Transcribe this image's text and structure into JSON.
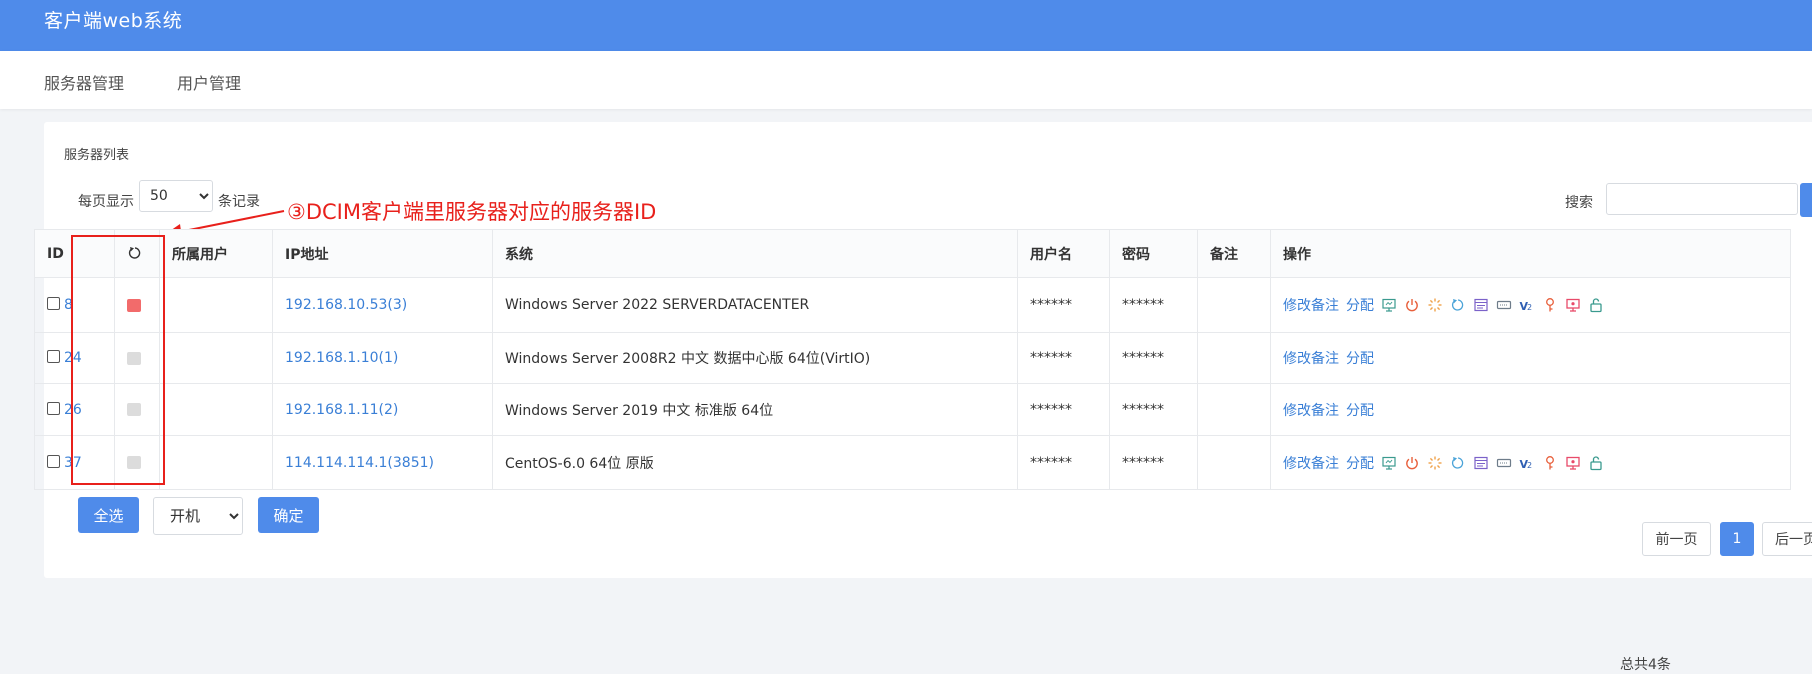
{
  "header": {
    "title": "客户端web系统"
  },
  "nav": {
    "items": [
      {
        "label": "服务器管理"
      },
      {
        "label": "用户管理"
      }
    ]
  },
  "card": {
    "title": "服务器列表"
  },
  "controls": {
    "page_size_label": "每页显示",
    "page_size_value": "50",
    "records_label": "条记录",
    "search_label": "搜索",
    "search_placeholder": ""
  },
  "annotation": {
    "text": "③DCIM客户端里服务器对应的服务器ID",
    "color": "#e8201b"
  },
  "table": {
    "columns": [
      "ID",
      "所属用户",
      "IP地址",
      "系统",
      "用户名",
      "密码",
      "备注",
      "操作"
    ],
    "rows": [
      {
        "id": "8",
        "status_color": "#f26b6b",
        "owner": "",
        "ip": "192.168.10.53(3)",
        "os": "Windows Server 2022 SERVERDATACENTER",
        "user": "******",
        "password": "******",
        "note": "",
        "full_actions": true
      },
      {
        "id": "24",
        "status_color": "#dcdcdc",
        "owner": "",
        "ip": "192.168.1.10(1)",
        "os": "Windows Server 2008R2 中文 数据中心版 64位(VirtIO)",
        "user": "******",
        "password": "******",
        "note": "",
        "full_actions": false
      },
      {
        "id": "26",
        "status_color": "#dcdcdc",
        "owner": "",
        "ip": "192.168.1.11(2)",
        "os": "Windows Server 2019 中文 标准版 64位",
        "user": "******",
        "password": "******",
        "note": "",
        "full_actions": false
      },
      {
        "id": "37",
        "status_color": "#dcdcdc",
        "owner": "",
        "ip": "114.114.114.1(3851)",
        "os": "CentOS-6.0 64位 原版",
        "user": "******",
        "password": "******",
        "note": "",
        "full_actions": true
      }
    ],
    "action_labels": {
      "edit_note": "修改备注",
      "assign": "分配"
    },
    "action_icons": [
      "monitor-icon",
      "power-icon",
      "loading-icon",
      "restart-icon",
      "console-icon",
      "hdd-icon",
      "vnc-icon",
      "key-icon",
      "screen-icon",
      "unlock-icon"
    ]
  },
  "footer": {
    "select_all_label": "全选",
    "action_value": "开机",
    "confirm_label": "确定",
    "total_label": "总共4条",
    "prev_label": "前一页",
    "current_page": "1",
    "next_label": "后一页"
  },
  "colors": {
    "primary": "#4f8bea",
    "link": "#3a7fd6",
    "annotation": "#e8201b",
    "status_on": "#f26b6b",
    "status_off": "#dcdcdc"
  }
}
